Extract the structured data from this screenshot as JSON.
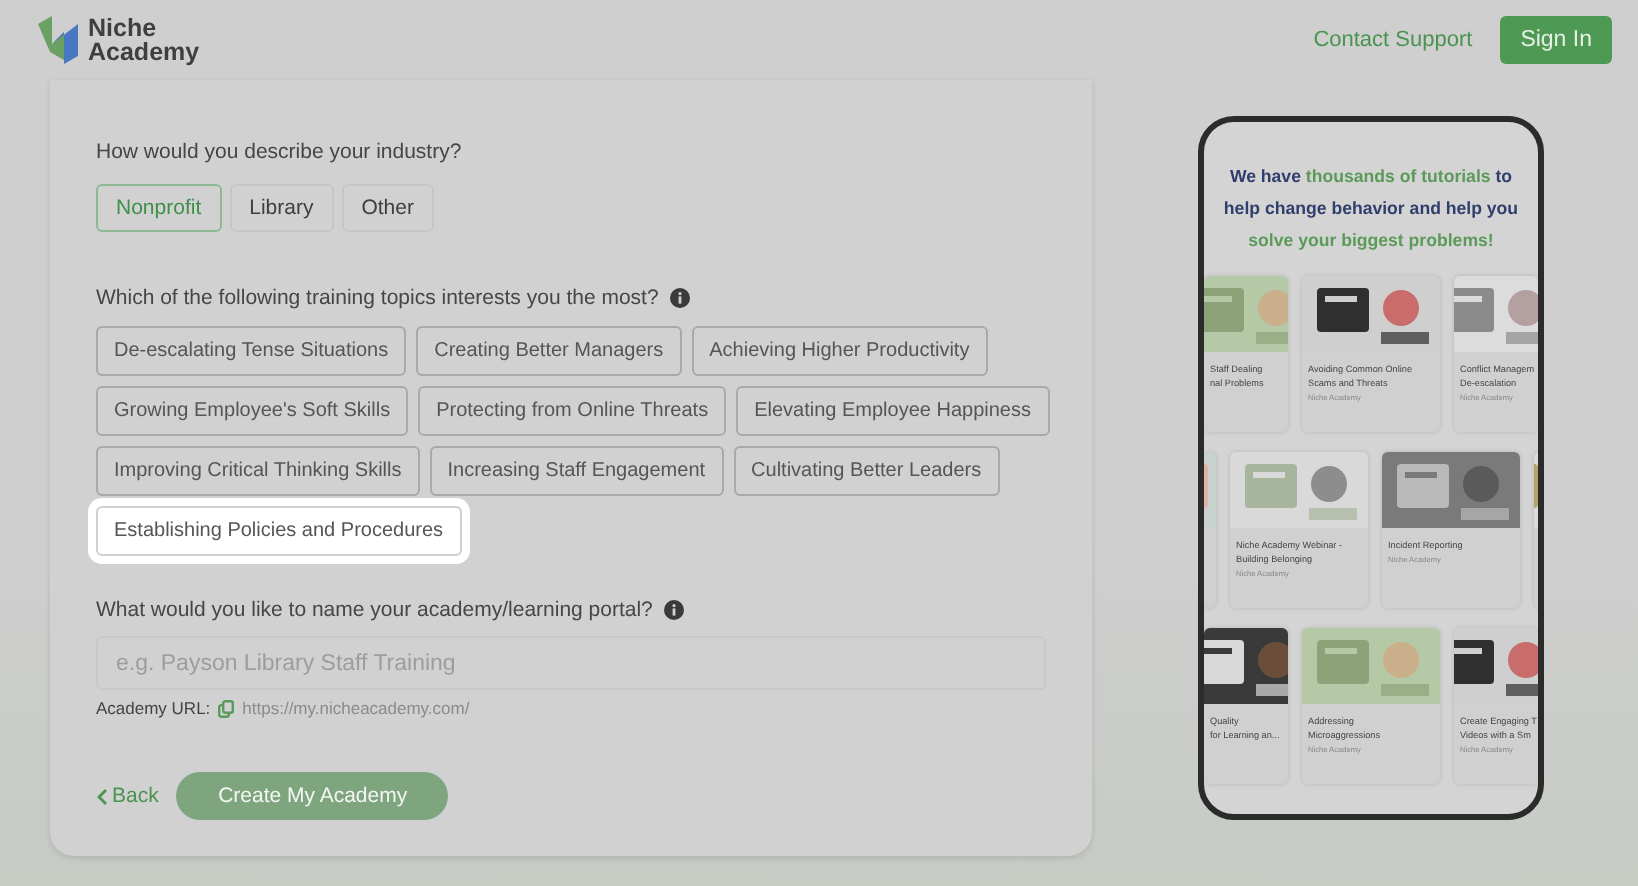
{
  "header": {
    "logo_lines": [
      "Niche",
      "Academy"
    ],
    "contact_link": "Contact Support",
    "sign_in": "Sign In"
  },
  "industry": {
    "question": "How would you describe your industry?",
    "options": [
      {
        "label": "Nonprofit",
        "selected": true
      },
      {
        "label": "Library",
        "selected": false
      },
      {
        "label": "Other",
        "selected": false
      }
    ]
  },
  "topics": {
    "question": "Which of the following training topics interests you the most?",
    "rows": [
      [
        {
          "label": "De-escalating Tense Situations",
          "highlighted": false
        },
        {
          "label": "Creating Better Managers",
          "highlighted": false
        },
        {
          "label": "Achieving Higher Productivity",
          "highlighted": false
        }
      ],
      [
        {
          "label": "Growing Employee's Soft Skills",
          "highlighted": false
        },
        {
          "label": "Protecting from Online Threats",
          "highlighted": false
        },
        {
          "label": "Elevating Employee Happiness",
          "highlighted": false
        }
      ],
      [
        {
          "label": "Improving Critical Thinking Skills",
          "highlighted": false
        },
        {
          "label": "Increasing Staff Engagement",
          "highlighted": false
        },
        {
          "label": "Cultivating Better Leaders",
          "highlighted": false
        }
      ],
      [
        {
          "label": "Establishing Policies and Procedures",
          "highlighted": true
        }
      ]
    ]
  },
  "academy_name": {
    "question": "What would you like to name your academy/learning portal?",
    "placeholder": "e.g. Payson Library Staff Training",
    "url_label": "Academy URL:",
    "url": "https://my.nicheacademy.com/"
  },
  "actions": {
    "back": "Back",
    "create": {
      "label": "Create My Academy",
      "disabled": true
    }
  },
  "phone": {
    "headline": [
      {
        "text": "We have ",
        "accent": false
      },
      {
        "text": "thousands of tutorials",
        "accent": true
      },
      {
        "text": " to help change behavior and help you ",
        "accent": false
      },
      {
        "text": "solve your biggest problems!",
        "accent": true
      }
    ],
    "card_rows": [
      [
        {
          "kind": "partial",
          "lines": [
            "Staff Dealing",
            "nal Problems"
          ]
        },
        {
          "kind": "full",
          "lines": [
            "Avoiding Common Online",
            "Scams and Threats"
          ],
          "author": "Niche Academy"
        },
        {
          "kind": "partial",
          "lines": [
            "Conflict Managem",
            "De-escalation"
          ],
          "author": "Niche Academy"
        }
      ],
      [
        {
          "kind": "sliver"
        },
        {
          "kind": "full",
          "lines": [
            "Niche Academy Webinar -",
            "Building Belonging"
          ],
          "author": "Niche Academy"
        },
        {
          "kind": "full",
          "lines": [
            "Incident Reporting"
          ],
          "author": "Niche Academy"
        },
        {
          "kind": "sliver"
        }
      ],
      [
        {
          "kind": "partial",
          "lines": [
            "Quality",
            "for Learning an..."
          ]
        },
        {
          "kind": "full",
          "lines": [
            "Addressing",
            "Microaggressions"
          ],
          "author": "Niche Academy"
        },
        {
          "kind": "partial",
          "lines": [
            "Create Engaging T",
            "Videos with a Sm"
          ],
          "author": "Niche Academy"
        }
      ]
    ]
  }
}
